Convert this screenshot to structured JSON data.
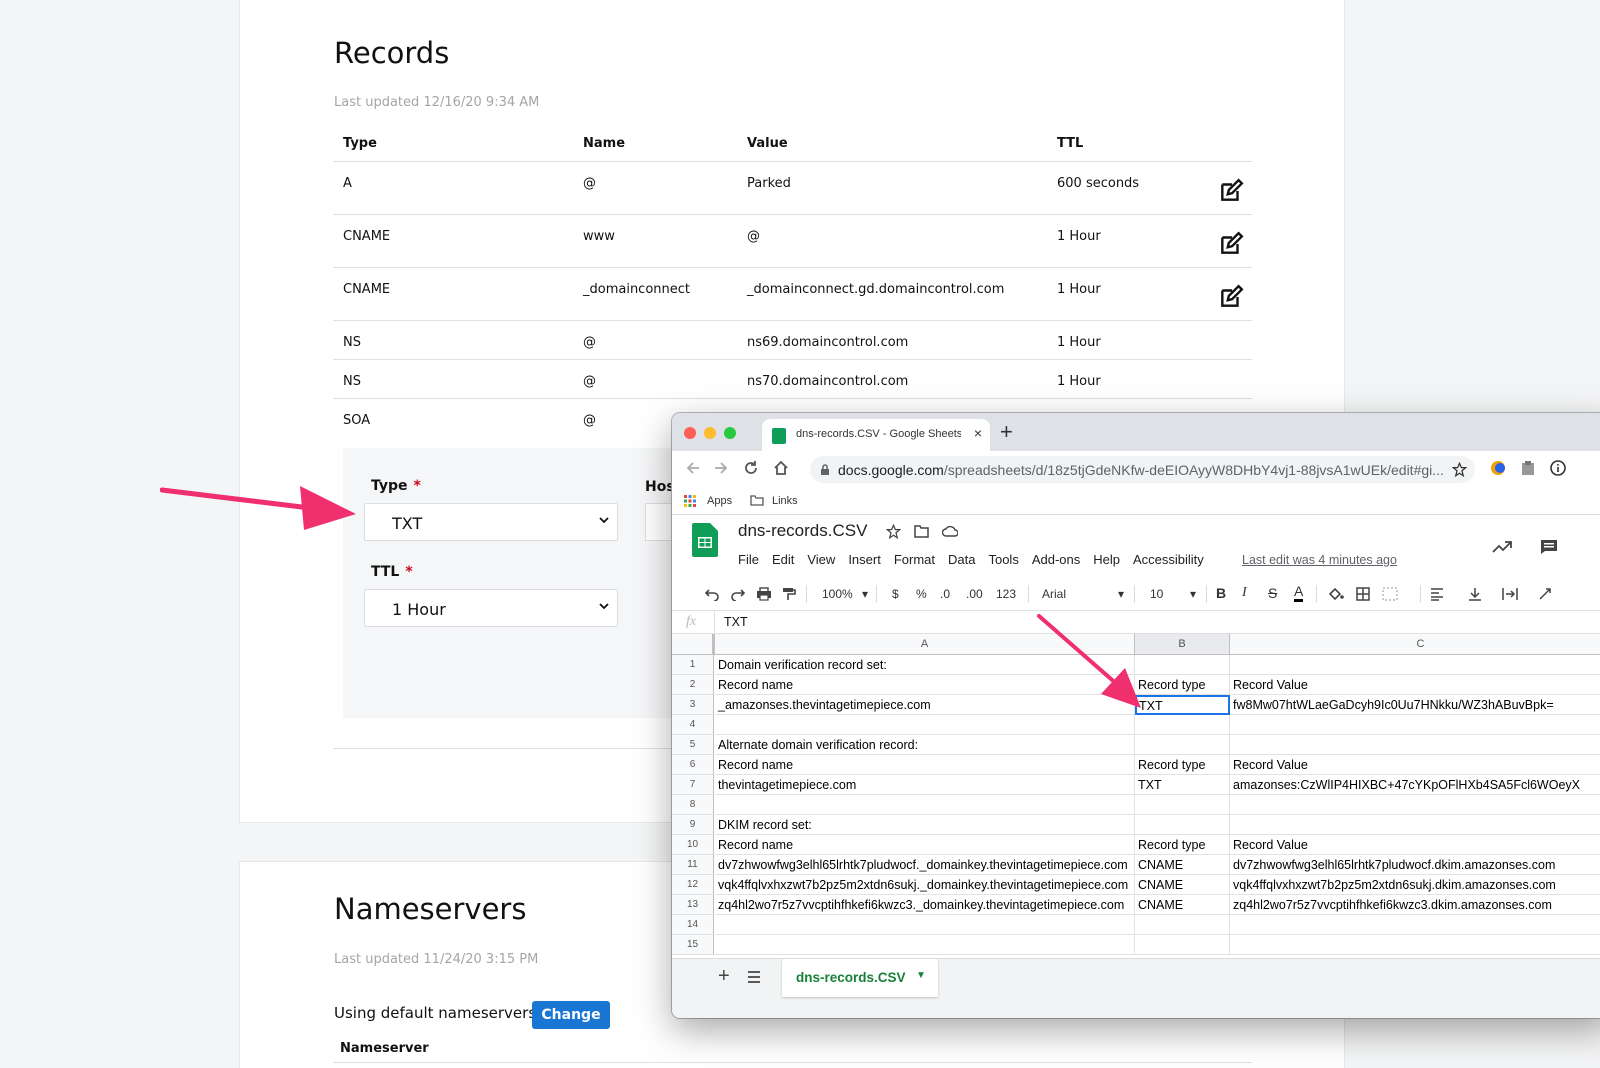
{
  "records": {
    "title": "Records",
    "last_updated": "Last updated 12/16/20 9:34 AM",
    "headers": {
      "type": "Type",
      "name": "Name",
      "value": "Value",
      "ttl": "TTL"
    },
    "rows": [
      {
        "type": "A",
        "name": "@",
        "value": "Parked",
        "ttl": "600 seconds"
      },
      {
        "type": "CNAME",
        "name": "www",
        "value": "@",
        "ttl": "1 Hour"
      },
      {
        "type": "CNAME",
        "name": "_domainconnect",
        "value": "_domainconnect.gd.domaincontrol.com",
        "ttl": "1 Hour"
      },
      {
        "type": "NS",
        "name": "@",
        "value": "ns69.domaincontrol.com",
        "ttl": "1 Hour"
      },
      {
        "type": "NS",
        "name": "@",
        "value": "ns70.domaincontrol.com",
        "ttl": "1 Hour"
      },
      {
        "type": "SOA",
        "name": "@",
        "value": "",
        "ttl": ""
      }
    ],
    "form": {
      "type_label": "Type",
      "type_value": "TXT",
      "ttl_label": "TTL",
      "ttl_value": "1 Hour",
      "required_mark": "*",
      "host_label": "Host"
    }
  },
  "nameservers": {
    "title": "Nameservers",
    "last_updated": "Last updated 11/24/20 3:15 PM",
    "using_text": "Using default nameservers",
    "change_label": "Change",
    "column_header": "Nameserver"
  },
  "browser": {
    "tab_title": "dns-records.CSV - Google Sheets",
    "tab_close": "×",
    "new_tab": "+",
    "url_domain": "docs.google.com",
    "url_path": "/spreadsheets/d/18z5tjGdeNKfw-deEIOAyyW8DHbY4vj1-88jvsA1wUEk/edit#gi...",
    "bookmarks": {
      "apps": "Apps",
      "links": "Links"
    }
  },
  "sheet": {
    "title": "dns-records.CSV",
    "menu": [
      "File",
      "Edit",
      "View",
      "Insert",
      "Format",
      "Data",
      "Tools",
      "Add-ons",
      "Help",
      "Accessibility"
    ],
    "last_edit": "Last edit was 4 minutes ago",
    "toolbar": {
      "zoom": "100%",
      "currency": "$",
      "percent": "%",
      "dec_less": ".0",
      "dec_more": ".00",
      "more_formats": "123",
      "font": "Arial",
      "size": "10",
      "bold": "B",
      "italic": "I",
      "strike": "S",
      "text_color": "A"
    },
    "fx_label": "fx",
    "formula": "TXT",
    "columns": [
      "A",
      "B",
      "C"
    ],
    "rows": [
      {
        "n": "1",
        "a": "Domain verification record set:",
        "b": "",
        "c": ""
      },
      {
        "n": "2",
        "a": "Record name",
        "b": "Record type",
        "c": "Record Value"
      },
      {
        "n": "3",
        "a": "_amazonses.thevintagetimepiece.com",
        "b": "TXT",
        "c": "fw8Mw07htWLaeGaDcyh9Ic0Uu7HNkku/WZ3hABuvBpk="
      },
      {
        "n": "4",
        "a": "",
        "b": "",
        "c": ""
      },
      {
        "n": "5",
        "a": "Alternate domain verification record:",
        "b": "",
        "c": ""
      },
      {
        "n": "6",
        "a": "Record name",
        "b": "Record type",
        "c": "Record Value"
      },
      {
        "n": "7",
        "a": "thevintagetimepiece.com",
        "b": "TXT",
        "c": "amazonses:CzWlIP4HIXBC+47cYKpOFlHXb4SA5Fcl6WOeyX"
      },
      {
        "n": "8",
        "a": "",
        "b": "",
        "c": ""
      },
      {
        "n": "9",
        "a": "DKIM record set:",
        "b": "",
        "c": ""
      },
      {
        "n": "10",
        "a": "Record name",
        "b": "Record type",
        "c": "Record Value"
      },
      {
        "n": "11",
        "a": "dv7zhwowfwg3elhl65lrhtk7pludwocf._domainkey.thevintagetimepiece.com",
        "b": "CNAME",
        "c": "dv7zhwowfwg3elhl65lrhtk7pludwocf.dkim.amazonses.com"
      },
      {
        "n": "12",
        "a": "vqk4ffqlvxhxzwt7b2pz5m2xtdn6sukj._domainkey.thevintagetimepiece.com",
        "b": "CNAME",
        "c": "vqk4ffqlvxhxzwt7b2pz5m2xtdn6sukj.dkim.amazonses.com"
      },
      {
        "n": "13",
        "a": "zq4hl2wo7r5z7vvcptihfhkefi6kwzc3._domainkey.thevintagetimepiece.com",
        "b": "CNAME",
        "c": "zq4hl2wo7r5z7vvcptihfhkefi6kwzc3.dkim.amazonses.com"
      },
      {
        "n": "14",
        "a": "",
        "b": "",
        "c": ""
      },
      {
        "n": "15",
        "a": "",
        "b": "",
        "c": ""
      }
    ],
    "active_cell": "B3",
    "sheet_tab": "dns-records.CSV"
  },
  "colors": {
    "arrow": "#f0306e",
    "change_button": "#1976d2",
    "sheets_green": "#0f9d58",
    "selection": "#1a73e8"
  }
}
